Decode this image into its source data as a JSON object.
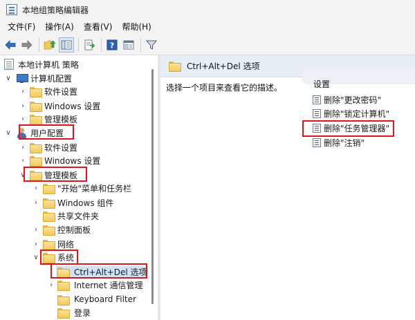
{
  "window": {
    "title": "本地组策略编辑器"
  },
  "menu": {
    "items": [
      "文件(F)",
      "操作(A)",
      "查看(V)",
      "帮助(H)"
    ]
  },
  "toolbar": {
    "buttons": [
      "back-arrow-icon",
      "forward-arrow-icon",
      "up-folder-icon",
      "show-hide-tree-icon",
      "export-list-icon",
      "help-icon",
      "properties-icon",
      "filter-icon"
    ]
  },
  "tree": {
    "root": "本地计算机 策略",
    "computer_config": "计算机配置",
    "cc_software": "软件设置",
    "cc_windows": "Windows 设置",
    "cc_admin": "管理模板",
    "user_config": "用户配置",
    "uc_software": "软件设置",
    "uc_windows": "Windows 设置",
    "uc_admin": "管理模板",
    "start_menu": "\"开始\"菜单和任务栏",
    "win_components": "Windows 组件",
    "shared_folders": "共享文件夹",
    "control_panel": "控制面板",
    "network": "网络",
    "system": "系统",
    "cad_options": "Ctrl+Alt+Del 选项",
    "internet_comm": "Internet 通信管理",
    "keyboard_filter": "Keyboard Filter",
    "logon": "登录"
  },
  "right": {
    "header": "Ctrl+Alt+Del 选项",
    "description": "选择一个项目来查看它的描述。",
    "settings_header": "设置",
    "settings": [
      "删除\"更改密码\"",
      "删除\"锁定计算机\"",
      "删除\"任务管理器\"",
      "删除\"注销\""
    ]
  },
  "highlight_color": "#e0141e",
  "selection_color": "#cfe3f7"
}
